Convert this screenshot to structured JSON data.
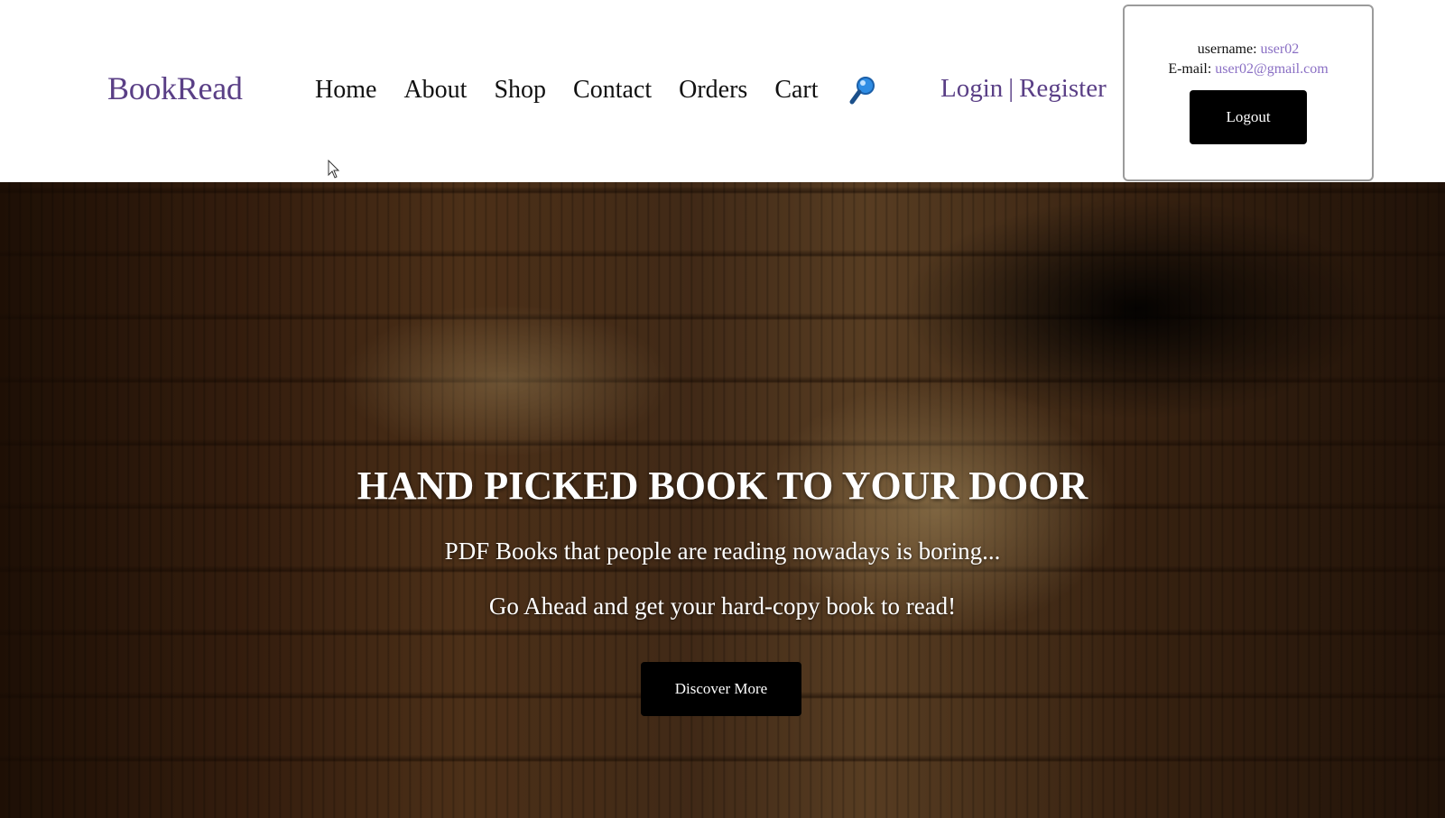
{
  "header": {
    "logo": "BookRead",
    "nav": [
      {
        "label": "Home"
      },
      {
        "label": "About"
      },
      {
        "label": "Shop"
      },
      {
        "label": "Contact"
      },
      {
        "label": "Orders"
      },
      {
        "label": "Cart"
      }
    ],
    "search_icon": "magnifier-icon",
    "auth": {
      "login_label": "Login",
      "separator": "|",
      "register_label": "Register"
    }
  },
  "user_box": {
    "username_label": "username:",
    "username_value": "user02",
    "email_label": "E-mail:",
    "email_value": "user02@gmail.com",
    "logout_label": "Logout"
  },
  "hero": {
    "title": "HAND PICKED BOOK TO YOUR DOOR",
    "subtitle_1": "PDF Books that people are reading nowadays is boring...",
    "subtitle_2": "Go Ahead and get your hard-copy book to read!",
    "button_label": "Discover More"
  },
  "colors": {
    "brand": "#5a3f86",
    "user_value": "#8a6fc4",
    "button_bg": "#000000"
  }
}
